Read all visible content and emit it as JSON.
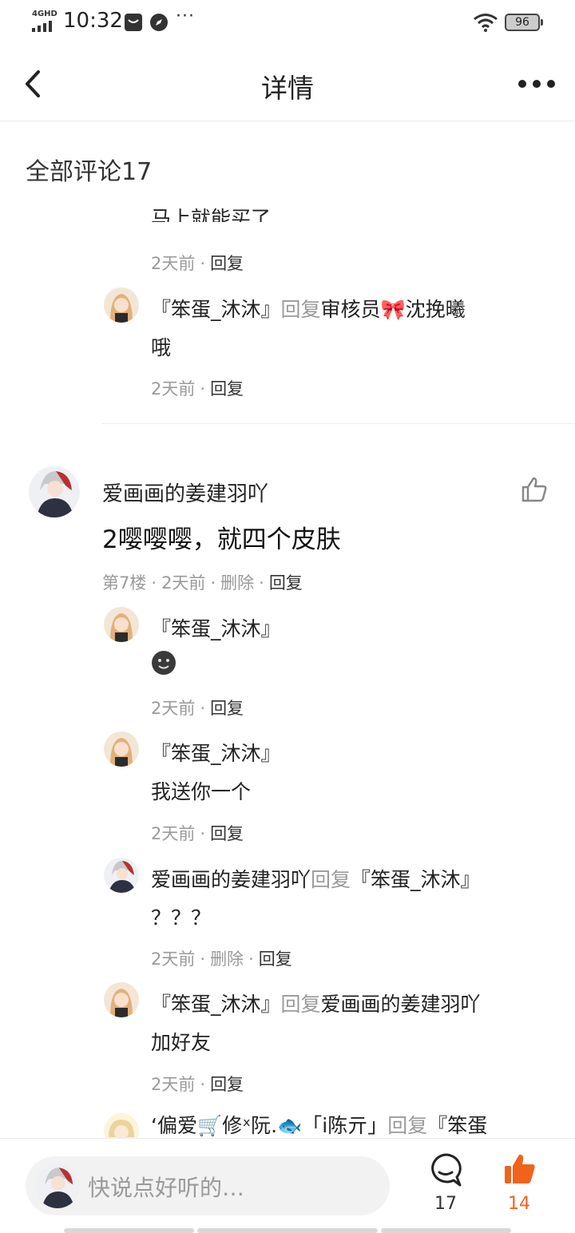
{
  "status_bar": {
    "network": "4GHD",
    "time": "10:32",
    "more": "···",
    "battery": "96"
  },
  "nav": {
    "title": "详情"
  },
  "comments_header": "全部评论17",
  "thread_prev": {
    "partial_text": "马上就能买了",
    "partial_meta": {
      "time": "2天前",
      "reply": "回复"
    },
    "reply": {
      "author": "『笨蛋_沐沐』",
      "reply_word": "回复",
      "target": "审核员🎀沈挽曦",
      "text": "哦",
      "time": "2天前",
      "reply_action": "回复"
    }
  },
  "main_comment": {
    "author": "爱画画的姜建羽吖",
    "text": "2嘤嘤嘤，就四个皮肤",
    "floor": "第7楼",
    "time": "2天前",
    "delete": "删除",
    "reply": "回复",
    "replies": [
      {
        "author": "『笨蛋_沐沐』",
        "text": "",
        "time": "2天前",
        "action": "回复"
      },
      {
        "author": "『笨蛋_沐沐』",
        "text": "我送你一个",
        "time": "2天前",
        "action": "回复"
      },
      {
        "author": "爱画画的姜建羽吖",
        "reply_word": "回复",
        "target": "『笨蛋_沐沐』",
        "text": "？？？",
        "time": "2天前",
        "delete": "删除",
        "action": "回复"
      },
      {
        "author": "『笨蛋_沐沐』",
        "reply_word": "回复",
        "target": "爱画画的姜建羽吖",
        "text": "加好友",
        "time": "2天前",
        "action": "回复"
      },
      {
        "author": "‘偏爱🛒修ˣ阮.🐟「i陈亓」",
        "reply_word": "回复",
        "target": "『笨蛋"
      }
    ]
  },
  "bottom_bar": {
    "placeholder": "快说点好听的…",
    "comment_count": "17",
    "like_count": "14",
    "like_color": "#f0631a"
  }
}
